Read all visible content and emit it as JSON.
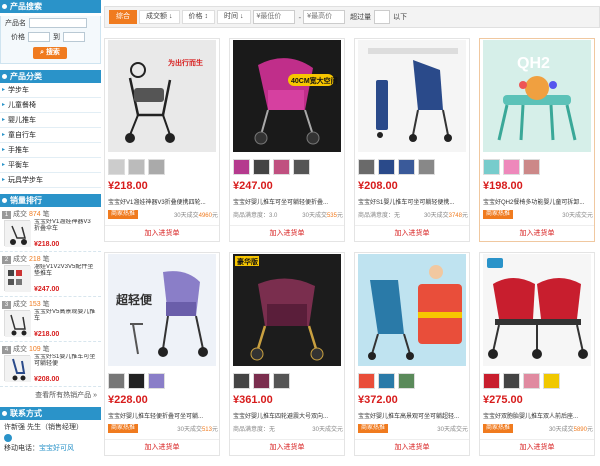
{
  "sidebar": {
    "search": {
      "title": "产品搜索",
      "name_label": "产品名",
      "price_label": "价格",
      "to_label": "到",
      "button": "搜索"
    },
    "categories": {
      "title": "产品分类",
      "items": [
        "学步车",
        "儿童餐椅",
        "婴儿推车",
        "童自行车",
        "手推车",
        "平衡车",
        "玩具学步车"
      ]
    },
    "ranking": {
      "title": "销量排行",
      "items": [
        {
          "num": "1",
          "count_prefix": "成交",
          "count": "874",
          "unit": "笔",
          "title": "宝宝好V1溜娃神器V3折叠伞车",
          "price": "¥218.00"
        },
        {
          "num": "2",
          "count_prefix": "成交",
          "count": "218",
          "unit": "笔",
          "title": "溜娃V1V2V3V5配件坐垫推车",
          "price": "¥247.00"
        },
        {
          "num": "3",
          "count_prefix": "成交",
          "count": "153",
          "unit": "笔",
          "title": "宝宝好V5高景观婴儿推车",
          "price": "¥218.00"
        },
        {
          "num": "4",
          "count_prefix": "成交",
          "count": "109",
          "unit": "笔",
          "title": "宝宝好S1婴儿推车可坐可躺轻便",
          "price": "¥208.00"
        }
      ],
      "more": "查看所有热销产品 »"
    },
    "contact": {
      "title": "联系方式",
      "person": "许新强 先生（销售经理）",
      "phone_label": "移动电话：",
      "phone": "宝宝好可风"
    }
  },
  "sortbar": {
    "items": [
      "综合",
      "成交额",
      "价格",
      "时间"
    ],
    "price_min_placeholder": "¥最低价",
    "price_max_placeholder": "¥最高价",
    "over_label": "超过量",
    "below_label": "以下"
  },
  "products": [
    {
      "price": "¥218.00",
      "title": "宝宝好V1溜娃神器V3折叠便携四轮...",
      "badge": "商家热推",
      "sold_prefix": "30天成交",
      "sold": "4960",
      "sold_unit": "元",
      "cart": "加入进货单",
      "img_text": "为出行而生"
    },
    {
      "price": "¥247.00",
      "title": "宝宝好婴儿推车可坐可躺轻便折叠...",
      "badge": "商品满意度：3.0",
      "sold_prefix": "30天成交",
      "sold": "535",
      "sold_unit": "元",
      "cart": "加入进货单",
      "img_text": "40CM宽大空间"
    },
    {
      "price": "¥208.00",
      "title": "宝宝好S1婴儿推车可坐可躺轻便携...",
      "badge": "商品满意度：无",
      "sold_prefix": "30天成交",
      "sold": "3748",
      "sold_unit": "元",
      "cart": "加入进货单",
      "img_text": ""
    },
    {
      "price": "¥198.00",
      "title": "宝宝好QH2餐椅多功能婴儿童可拆卸...",
      "badge": "商家热推",
      "sold_prefix": "30天成交",
      "sold": "",
      "sold_unit": "元",
      "cart": "加入进货单",
      "img_text": "QH2"
    },
    {
      "price": "¥228.00",
      "title": "宝宝好婴儿推车轻便折叠可坐可躺...",
      "badge": "商家热推",
      "sold_prefix": "30天成交",
      "sold": "513",
      "sold_unit": "元",
      "cart": "加入进货单",
      "img_text": "超轻便"
    },
    {
      "price": "¥361.00",
      "title": "宝宝好婴儿推车四轮避震大号双向...",
      "badge": "商品满意度：无",
      "sold_prefix": "30天成交",
      "sold": "",
      "sold_unit": "元",
      "cart": "加入进货单",
      "img_text": "豪华版"
    },
    {
      "price": "¥372.00",
      "title": "宝宝好婴儿推车高景观可坐可躺超轻...",
      "badge": "商家热推",
      "sold_prefix": "30天成交",
      "sold": "",
      "sold_unit": "元",
      "cart": "加入进货单",
      "img_text": ""
    },
    {
      "price": "¥275.00",
      "title": "宝宝好双胞胎婴儿推车双人前后座...",
      "badge": "商家热推",
      "sold_prefix": "30天成交",
      "sold": "5890",
      "sold_unit": "元",
      "cart": "加入进货单",
      "img_text": ""
    }
  ],
  "colors": {
    "accent": "#f07b1f",
    "brand_blue": "#2a93c9",
    "price_red": "#d71c1c"
  }
}
